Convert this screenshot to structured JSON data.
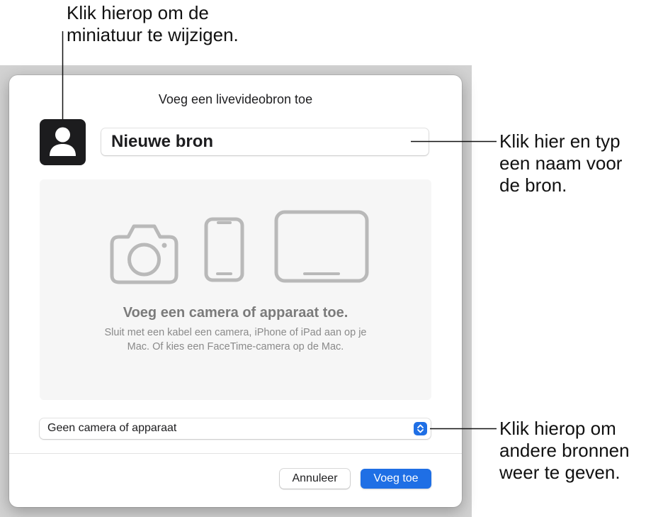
{
  "dialog": {
    "title": "Voeg een livevideobron toe",
    "thumbnail_icon": "person-silhouette-icon",
    "name_value": "Nieuwe bron",
    "drop_area": {
      "icons": [
        "camera-icon",
        "iphone-icon",
        "ipad-icon"
      ],
      "heading": "Voeg een camera of apparaat toe.",
      "body_line_1": "Sluit met een kabel een camera, iPhone of iPad aan op je",
      "body_line_2": "Mac. Of kies een FaceTime-camera op de Mac."
    },
    "source_select": {
      "selected": "Geen camera of apparaat",
      "icon": "chevron-up-down-icon"
    },
    "buttons": {
      "cancel": "Annuleer",
      "add": "Voeg toe"
    }
  },
  "callouts": {
    "thumbnail": {
      "line_1": "Klik hierop om de",
      "line_2": "miniatuur te wijzigen."
    },
    "name": {
      "line_1": "Klik hier en typ",
      "line_2": "een naam voor",
      "line_3": "de bron."
    },
    "select": {
      "line_1": "Klik hierop om",
      "line_2": "andere bronnen",
      "line_3": "weer te geven."
    }
  },
  "colors": {
    "accent": "#1f6fe5",
    "backdrop": "#d2d2d2",
    "dialog_background": "#ffffff",
    "drop_area_background": "#f6f6f6",
    "device_icon_stroke": "#b9b9b9"
  }
}
